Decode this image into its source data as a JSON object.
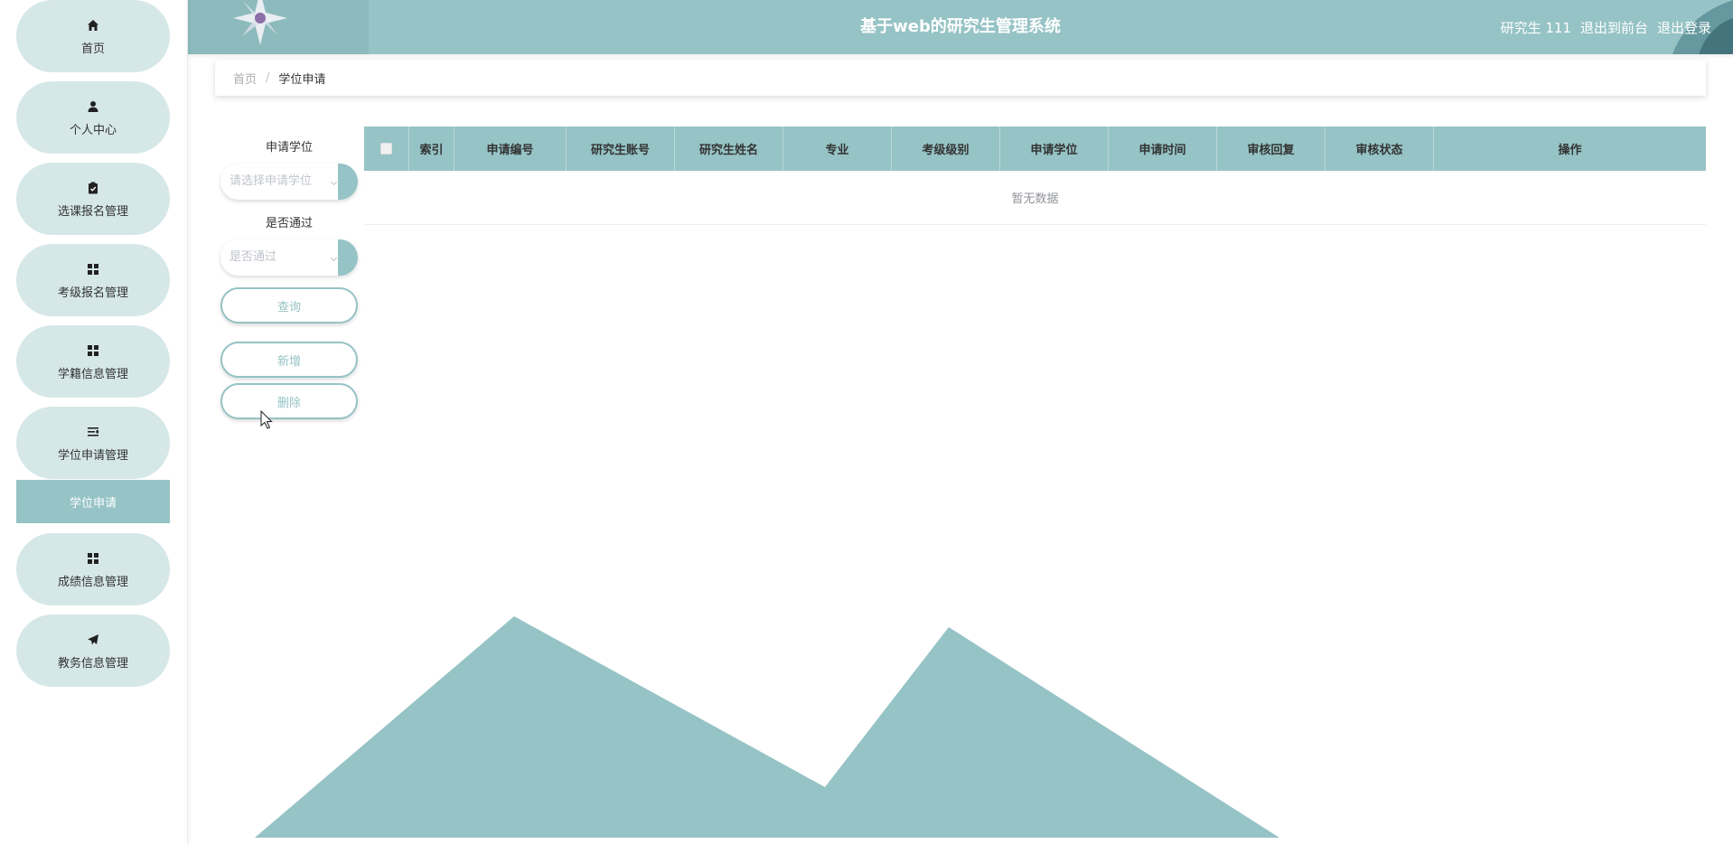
{
  "header": {
    "title": "基于web的研究生管理系统",
    "user": "研究生 111",
    "to_front": "退出到前台",
    "logout": "退出登录"
  },
  "sidebar": {
    "items": [
      {
        "label": "首页",
        "icon": "home-icon"
      },
      {
        "label": "个人中心",
        "icon": "user-icon"
      },
      {
        "label": "选课报名管理",
        "icon": "clipboard-icon"
      },
      {
        "label": "考级报名管理",
        "icon": "grid-icon"
      },
      {
        "label": "学籍信息管理",
        "icon": "grid-icon"
      },
      {
        "label": "学位申请管理",
        "icon": "list-icon"
      },
      {
        "label": "成绩信息管理",
        "icon": "grid-icon"
      },
      {
        "label": "教务信息管理",
        "icon": "paper-plane-icon"
      }
    ],
    "active_sub": "学位申请"
  },
  "breadcrumb": {
    "home": "首页",
    "separator": "/",
    "current": "学位申请"
  },
  "filters": {
    "degree_label": "申请学位",
    "degree_placeholder": "请选择申请学位",
    "pass_label": "是否通过",
    "pass_placeholder": "是否通过"
  },
  "buttons": {
    "query": "查询",
    "add": "新增",
    "delete": "删除"
  },
  "table": {
    "columns": [
      "索引",
      "申请编号",
      "研究生账号",
      "研究生姓名",
      "专业",
      "考级级别",
      "申请学位",
      "申请时间",
      "审核回复",
      "审核状态",
      "操作"
    ],
    "empty_text": "暂无数据"
  },
  "colors": {
    "primary": "#96c3c5",
    "menu_bg": "#d6e7e8"
  }
}
